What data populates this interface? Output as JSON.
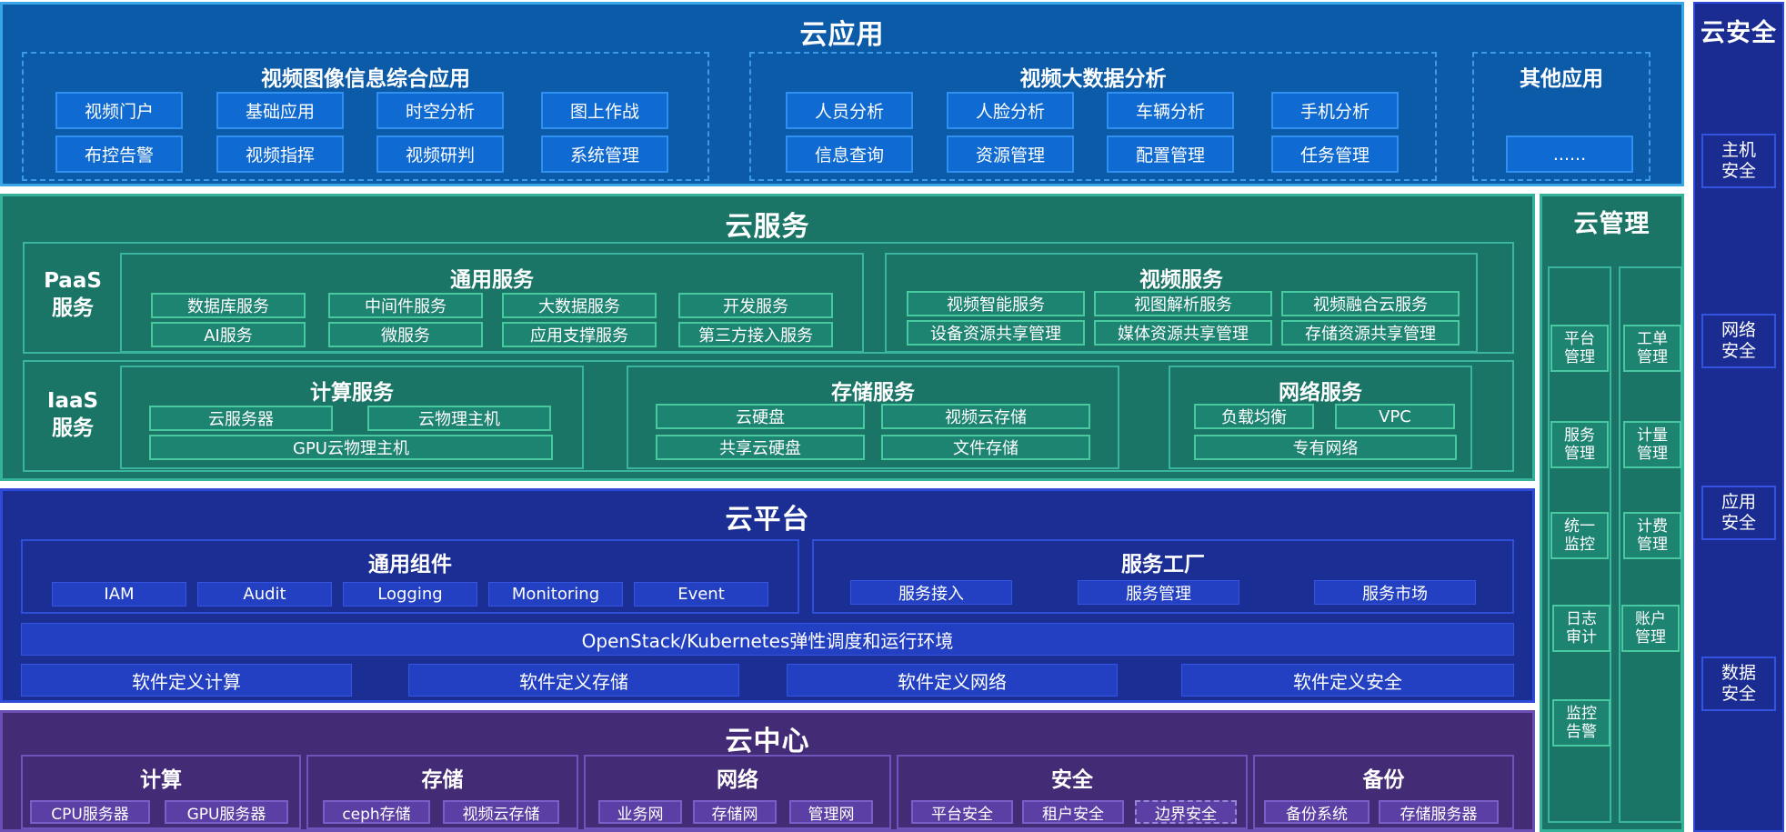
{
  "cloud_app": {
    "title": "云应用",
    "groups": [
      {
        "title": "视频图像信息综合应用",
        "items": [
          "视频门户",
          "基础应用",
          "时空分析",
          "图上作战",
          "布控告警",
          "视频指挥",
          "视频研判",
          "系统管理"
        ]
      },
      {
        "title": "视频大数据分析",
        "items": [
          "人员分析",
          "人脸分析",
          "车辆分析",
          "手机分析",
          "信息查询",
          "资源管理",
          "配置管理",
          "任务管理"
        ]
      },
      {
        "title": "其他应用",
        "items": [
          "......"
        ]
      }
    ]
  },
  "cloud_service": {
    "title": "云服务",
    "paas": {
      "label_line1": "PaaS",
      "label_line2": "服务",
      "general": {
        "title": "通用服务",
        "items": [
          "数据库服务",
          "中间件服务",
          "大数据服务",
          "开发服务",
          "AI服务",
          "微服务",
          "应用支撑服务",
          "第三方接入服务"
        ]
      },
      "video": {
        "title": "视频服务",
        "items": [
          "视频智能服务",
          "视图解析服务",
          "视频融合云服务",
          "设备资源共享管理",
          "媒体资源共享管理",
          "存储资源共享管理"
        ]
      }
    },
    "iaas": {
      "label_line1": "IaaS",
      "label_line2": "服务",
      "compute": {
        "title": "计算服务",
        "items": [
          "云服务器",
          "云物理主机",
          "GPU云物理主机"
        ]
      },
      "storage": {
        "title": "存储服务",
        "items": [
          "云硬盘",
          "视频云存储",
          "共享云硬盘",
          "文件存储"
        ]
      },
      "network": {
        "title": "网络服务",
        "items": [
          "负载均衡",
          "VPC",
          "专有网络"
        ]
      }
    }
  },
  "cloud_mgmt": {
    "title": "云管理",
    "left": [
      "平台管理",
      "服务管理",
      "统一监控",
      "日志审计",
      "监控告警"
    ],
    "right": [
      "工单管理",
      "计量管理",
      "计费管理",
      "账户管理"
    ]
  },
  "cloud_security": {
    "title": "云安全",
    "items": [
      "主机安全",
      "网络安全",
      "应用安全",
      "数据安全"
    ]
  },
  "cloud_platform": {
    "title": "云平台",
    "common": {
      "title": "通用组件",
      "items": [
        "IAM",
        "Audit",
        "Logging",
        "Monitoring",
        "Event"
      ]
    },
    "factory": {
      "title": "服务工厂",
      "items": [
        "服务接入",
        "服务管理",
        "服务市场"
      ]
    },
    "runtime": "OpenStack/Kubernetes弹性调度和运行环境",
    "sds": [
      "软件定义计算",
      "软件定义存储",
      "软件定义网络",
      "软件定义安全"
    ]
  },
  "cloud_center": {
    "title": "云中心",
    "groups": [
      {
        "title": "计算",
        "items": [
          "CPU服务器",
          "GPU服务器"
        ]
      },
      {
        "title": "存储",
        "items": [
          "ceph存储",
          "视频云存储"
        ]
      },
      {
        "title": "网络",
        "items": [
          "业务网",
          "存储网",
          "管理网"
        ]
      },
      {
        "title": "安全",
        "items": [
          "平台安全",
          "租户安全",
          "边界安全"
        ]
      },
      {
        "title": "备份",
        "items": [
          "备份系统",
          "存储服务器"
        ]
      }
    ]
  }
}
